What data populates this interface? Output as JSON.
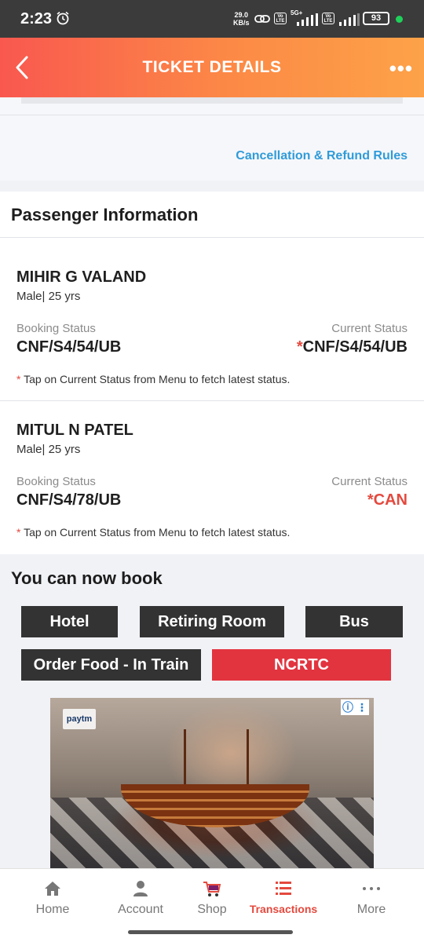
{
  "status_bar": {
    "time": "2:23",
    "speed_value": "29.0",
    "speed_unit": "KB/s",
    "volte_label": "Vo LTE",
    "network": "5G+",
    "battery": "93",
    "colors": {
      "background": "#3b3b3b",
      "dot": "#1fd15a"
    }
  },
  "header": {
    "title": "TICKET DETAILS",
    "more_label": "•••",
    "gradient": [
      "#f9584f",
      "#fda248"
    ]
  },
  "rules": {
    "link_label": "Cancellation & Refund Rules",
    "link_color": "#2f9bd9"
  },
  "passenger_section": {
    "title": "Passenger Information",
    "booking_status_label": "Booking Status",
    "current_status_label": "Current Status",
    "star": "*",
    "note": "Tap on Current Status from Menu to fetch latest status.",
    "passengers": [
      {
        "name": "MIHIR G VALAND",
        "details": "Male| 25 yrs",
        "booking_status": "CNF/S4/54/UB",
        "current_status": "CNF/S4/54/UB"
      },
      {
        "name": "MITUL N PATEL",
        "details": "Male| 25 yrs",
        "booking_status": "CNF/S4/78/UB",
        "current_status": "CAN"
      }
    ]
  },
  "book_section": {
    "title": "You can now book",
    "buttons": {
      "hotel": "Hotel",
      "retiring_room": "Retiring Room",
      "bus": "Bus",
      "order_food": "Order Food - In Train",
      "ncrtc": "NCRTC"
    },
    "ad": {
      "logo": "paytm",
      "info_label": "ⓘ ⋮"
    }
  },
  "bottom_nav": {
    "items": [
      {
        "label": "Home",
        "icon": "home-icon"
      },
      {
        "label": "Account",
        "icon": "account-icon"
      },
      {
        "label": "Shop",
        "icon": "shop-cart-icon"
      },
      {
        "label": "Transactions",
        "icon": "transactions-icon",
        "active": true
      },
      {
        "label": "More",
        "icon": "more-dots-icon"
      }
    ],
    "active_color": "#e4493e"
  }
}
